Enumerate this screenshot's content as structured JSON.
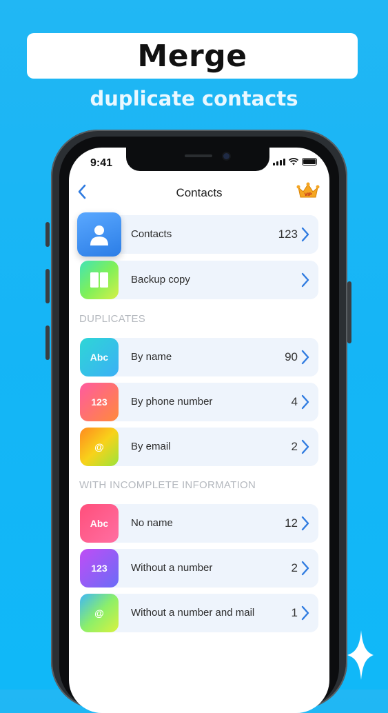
{
  "banner": {
    "title": "Merge"
  },
  "subtitle": "duplicate contacts",
  "status_bar": {
    "time": "9:41"
  },
  "nav": {
    "back_icon": "chevron-left-icon",
    "title": "Contacts",
    "vip_icon": "crown-vip-icon",
    "vip_text": "VIP"
  },
  "top_items": [
    {
      "label": "Contacts",
      "count": "123",
      "icon": "person-icon"
    },
    {
      "label": "Backup copy",
      "count": "",
      "icon": "book-icon"
    }
  ],
  "duplicates": {
    "header": "DUPLICATES",
    "items": [
      {
        "label": "By name",
        "count": "90",
        "tile_text": "Abc"
      },
      {
        "label": "By phone number",
        "count": "4",
        "tile_text": "123"
      },
      {
        "label": "By email",
        "count": "2",
        "tile_text": "@"
      }
    ]
  },
  "incomplete": {
    "header": "WITH INCOMPLETE INFORMATION",
    "items": [
      {
        "label": "No name",
        "count": "12",
        "tile_text": "Abc"
      },
      {
        "label": "Without a number",
        "count": "2",
        "tile_text": "123"
      },
      {
        "label": "Without a number and mail",
        "count": "1",
        "tile_text": "@"
      }
    ]
  },
  "colors": {
    "accent": "#2f7be0",
    "background": "#15b5f6",
    "row_bg": "#eef4fc"
  }
}
